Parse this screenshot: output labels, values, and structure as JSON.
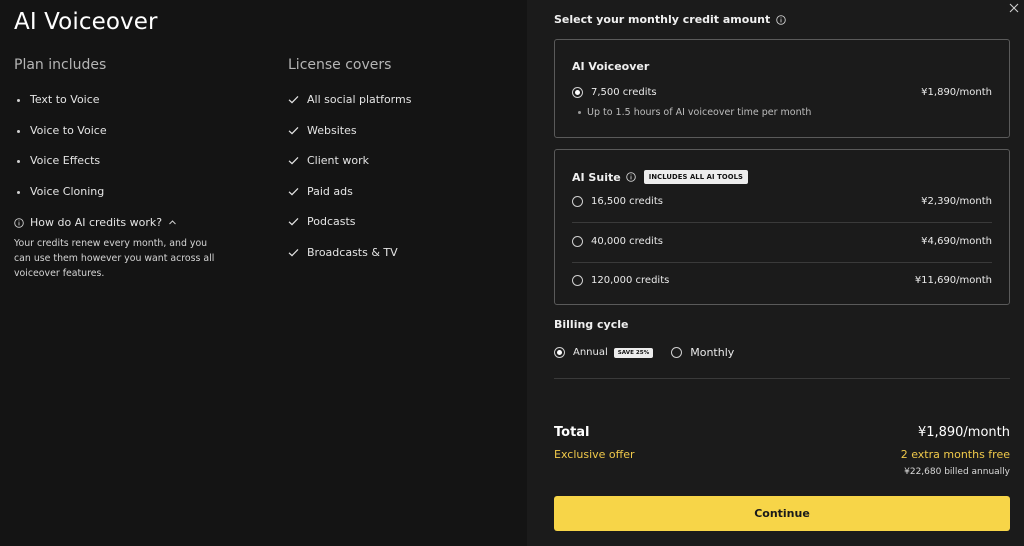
{
  "app": {
    "title": "AI Voiceover"
  },
  "plan": {
    "heading": "Plan includes",
    "items": [
      "Text to Voice",
      "Voice to Voice",
      "Voice Effects",
      "Voice Cloning"
    ]
  },
  "license": {
    "heading": "License covers",
    "items": [
      "All social platforms",
      "Websites",
      "Client work",
      "Paid ads",
      "Podcasts",
      "Broadcasts & TV"
    ]
  },
  "faq": {
    "question": "How do AI credits work?",
    "answer": "Your credits renew every month, and you can use them however you want across all voiceover features."
  },
  "credits": {
    "title": "Select your monthly credit amount",
    "voiceover": {
      "title": "AI Voiceover",
      "option": {
        "credits": "7,500 credits",
        "price": "¥1,890/month",
        "selected": true
      },
      "note": "Up to 1.5 hours of AI voiceover time per month"
    },
    "suite": {
      "title": "AI Suite",
      "badge": "INCLUDES ALL AI TOOLS",
      "options": [
        {
          "credits": "16,500 credits",
          "price": "¥2,390/month"
        },
        {
          "credits": "40,000 credits",
          "price": "¥4,690/month"
        },
        {
          "credits": "120,000 credits",
          "price": "¥11,690/month"
        }
      ]
    }
  },
  "billing": {
    "title": "Billing cycle",
    "annual": "Annual",
    "save_badge": "SAVE 25%",
    "monthly": "Monthly",
    "selected": "Annual"
  },
  "summary": {
    "total_label": "Total",
    "total_price": "¥1,890/month",
    "offer_label": "Exclusive offer",
    "offer_value": "2 extra months free",
    "billed": "¥22,680 billed annually"
  },
  "actions": {
    "continue": "Continue"
  },
  "colors": {
    "accent": "#f7d548",
    "offer": "#f0c94a",
    "panel": "#1b1b1b",
    "background": "#141414"
  }
}
